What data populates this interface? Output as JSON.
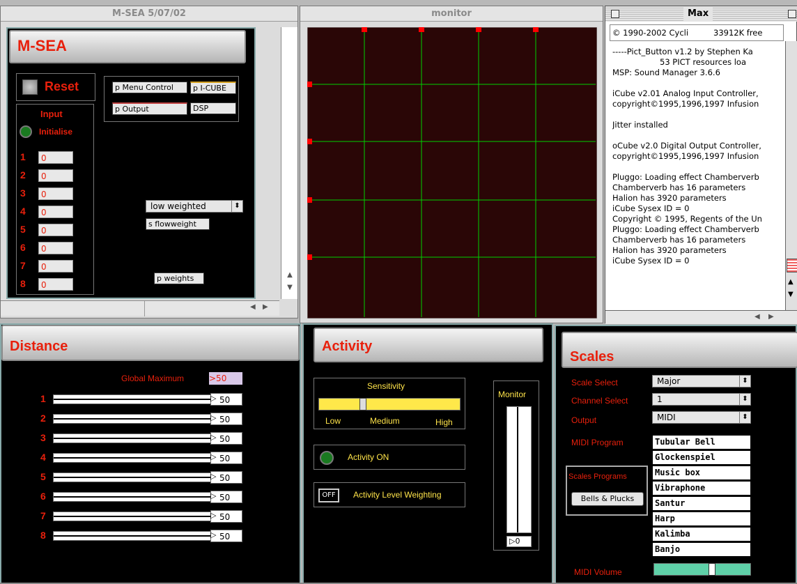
{
  "mseawin": {
    "title": "M-SEA 5/07/02",
    "banner": "M-SEA",
    "reset_label": "Reset",
    "input_label": "Input",
    "initialise_label": "Initialise",
    "inputs": [
      {
        "num": "1",
        "value": "0"
      },
      {
        "num": "2",
        "value": "0"
      },
      {
        "num": "3",
        "value": "0"
      },
      {
        "num": "4",
        "value": "0"
      },
      {
        "num": "5",
        "value": "0"
      },
      {
        "num": "6",
        "value": "0"
      },
      {
        "num": "7",
        "value": "0"
      },
      {
        "num": "8",
        "value": "0"
      }
    ],
    "menu_control": "p Menu Control",
    "icube": "p I-CUBE",
    "output": "p Output",
    "dsp": "DSP",
    "weighting_select": "low weighted",
    "flowweight": "s flowweight",
    "weights": "p weights"
  },
  "monitor": {
    "title": "monitor"
  },
  "maxwin": {
    "title": "Max",
    "copyright": "© 1990-2002 Cycli",
    "free_mem": "33912K free",
    "lines": [
      "-----Pict_Button v1.2 by Stephen Ka",
      "53 PICT resources loa",
      "MSP: Sound Manager 3.6.6",
      "",
      "iCube v2.01 Analog Input Controller,",
      "copyright©1995,1996,1997 Infusion",
      "",
      "Jitter installed",
      "",
      "oCube v2.0 Digital Output Controller,",
      "copyright©1995,1996,1997 Infusion",
      "",
      "Pluggo: Loading effect Chamberverb",
      "Chamberverb has 16 parameters",
      "Halion has 3920 parameters",
      "iCube Sysex ID = 0",
      "Copyright © 1995, Regents of the Un",
      "Pluggo: Loading effect Chamberverb",
      "Chamberverb has 16 parameters",
      "Halion has 3920 parameters",
      "iCube Sysex ID = 0"
    ]
  },
  "distance": {
    "banner": "Distance",
    "global_max_label": "Global Maximum",
    "global_max_value": ">50",
    "rows": [
      {
        "num": "1",
        "value": "50",
        "level": 1.0
      },
      {
        "num": "2",
        "value": "50",
        "level": 1.0
      },
      {
        "num": "3",
        "value": "50",
        "level": 1.0
      },
      {
        "num": "4",
        "value": "50",
        "level": 1.0
      },
      {
        "num": "5",
        "value": "50",
        "level": 1.0
      },
      {
        "num": "6",
        "value": "50",
        "level": 1.0
      },
      {
        "num": "7",
        "value": "50",
        "level": 1.0
      },
      {
        "num": "8",
        "value": "50",
        "level": 1.0
      }
    ]
  },
  "activity": {
    "banner": "Activity",
    "sensitivity_label": "Sensitivity",
    "sensitivity_level": 0.3,
    "low": "Low",
    "medium": "Medium",
    "high": "High",
    "activity_on": "Activity ON",
    "off_button": "OFF",
    "weighting_label": "Activity Level Weighting",
    "monitor_label": "Monitor",
    "monitor_value": "0"
  },
  "scales": {
    "banner": "Scales",
    "scale_select_label": "Scale Select",
    "scale_select_value": "Major",
    "channel_select_label": "Channel Select",
    "channel_select_value": "1",
    "output_label": "Output",
    "output_value": "MIDI",
    "midi_program_label": "MIDI Program",
    "scales_programs_label": "Scales Programs",
    "bells_button": "Bells & Plucks",
    "programs": [
      "Tubular Bell",
      "Glockenspiel",
      "Music box",
      "Vibraphone",
      "Santur",
      "Harp",
      "Kalimba",
      "Banjo"
    ],
    "midi_volume_label": "MIDI Volume",
    "midi_volume_level": 0.6
  },
  "colors": {
    "accent_red": "#e8200c",
    "grid_green": "#00d000",
    "label_yellow": "#ffe44a",
    "monitor_bg": "#2a0606"
  }
}
